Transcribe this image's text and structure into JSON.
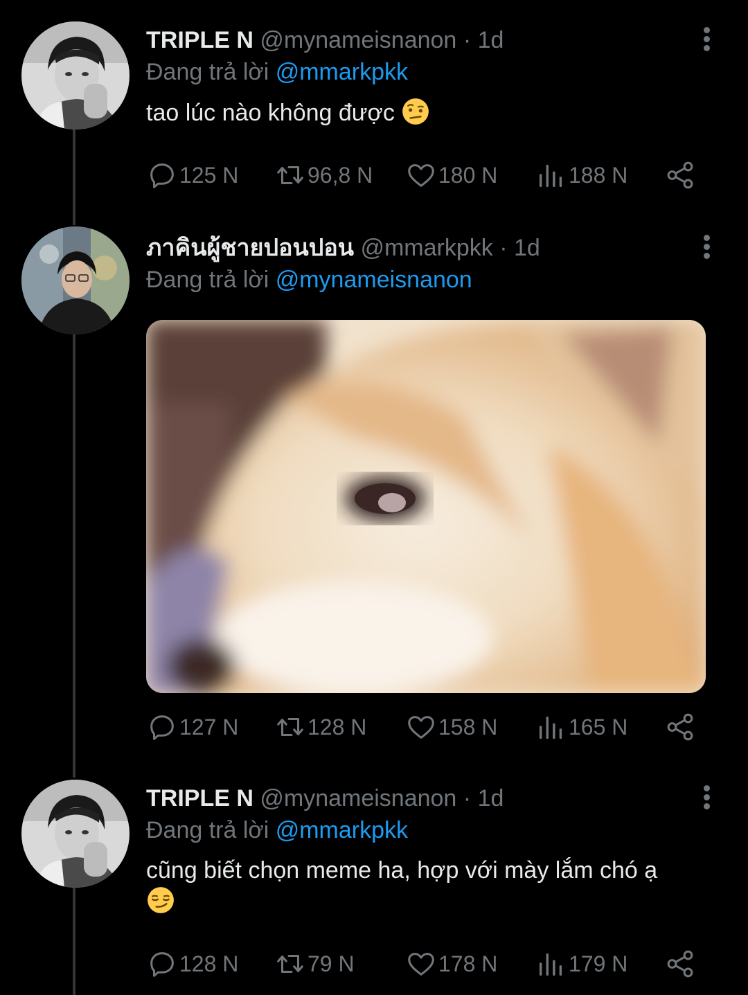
{
  "tweets": [
    {
      "display_name": "TRIPLE N",
      "handle": "@mynameisnanon",
      "separator": "·",
      "time": "1d",
      "reply_prefix": "Đang trả lời",
      "reply_to": "@mmarkpkk",
      "text": "tao lúc nào không được",
      "emoji": "raised-eyebrow-emoji",
      "stats": {
        "replies": "125 N",
        "retweets": "96,8 N",
        "likes": "180 N",
        "views": "188 N"
      }
    },
    {
      "display_name": "ภาคินผู้ชายปอนปอน",
      "handle": "@mmarkpkk",
      "separator": "·",
      "time": "1d",
      "reply_prefix": "Đang trả lời",
      "reply_to": "@mynameisnanon",
      "media": "corgi-meme-image",
      "stats": {
        "replies": "127 N",
        "retweets": "128 N",
        "likes": "158 N",
        "views": "165 N"
      }
    },
    {
      "display_name": "TRIPLE N",
      "handle": "@mynameisnanon",
      "separator": "·",
      "time": "1d",
      "reply_prefix": "Đang trả lời",
      "reply_to": "@mmarkpkk",
      "text": "cũng biết chọn meme ha, hợp với mày lắm chó ạ",
      "emoji": "smirk-emoji",
      "stats": {
        "replies": "128 N",
        "retweets": "79 N",
        "likes": "178 N",
        "views": "179 N"
      }
    }
  ],
  "icons": {
    "reply": "reply-icon",
    "retweet": "retweet-icon",
    "like": "heart-icon",
    "views": "views-icon",
    "share": "share-icon",
    "more": "more-vertical-icon"
  },
  "colors": {
    "background": "#000000",
    "text": "#e7e9ea",
    "muted": "#71767b",
    "link": "#1d9bf0",
    "thread_line": "#333639"
  }
}
